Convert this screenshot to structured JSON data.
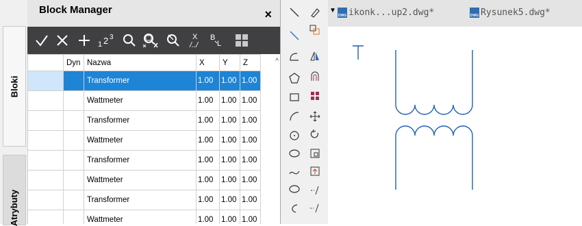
{
  "block_manager": {
    "title": "Block Manager",
    "close_label": "×",
    "side_tabs": {
      "blocks": "Bloki",
      "attributes": "Atrybuty"
    },
    "columns": [
      "",
      "Dyn",
      "Nazwa",
      "X",
      "Y",
      "Z"
    ],
    "rows": [
      {
        "name": "Transformer",
        "x": "1.00",
        "y": "1.00",
        "z": "1.00",
        "selected": true
      },
      {
        "name": "Wattmeter",
        "x": "1.00",
        "y": "1.00",
        "z": "1.00"
      },
      {
        "name": "Transformer",
        "x": "1.00",
        "y": "1.00",
        "z": "1.00"
      },
      {
        "name": "Wattmeter",
        "x": "1.00",
        "y": "1.00",
        "z": "1.00"
      },
      {
        "name": "Transformer",
        "x": "1.00",
        "y": "1.00",
        "z": "1.00"
      },
      {
        "name": "Wattmeter",
        "x": "1.00",
        "y": "1.00",
        "z": "1.00"
      },
      {
        "name": "Transformer",
        "x": "1.00",
        "y": "1.00",
        "z": "1.00"
      },
      {
        "name": "Wattmeter",
        "x": "1.00",
        "y": "1.00",
        "z": "1.00"
      }
    ],
    "toolbar_icons": [
      "check-icon",
      "cross-icon",
      "plus-icon",
      "numbering-icon",
      "search-icon",
      "select-zoom-icon",
      "pick-icon",
      "xy-icon",
      "bl-icon",
      "grid-view-icon"
    ]
  },
  "doc_tabs": [
    {
      "label": "ikonk...up2.dwg*"
    },
    {
      "label": "Rysunek5.dwg*"
    }
  ],
  "doc_tab_icon_text": "DWG",
  "drawing": {
    "text_mark": "T",
    "stroke_color": "#1f5fb8"
  },
  "colors": {
    "selected": "#1d84d6",
    "toolbar": "#404042"
  }
}
